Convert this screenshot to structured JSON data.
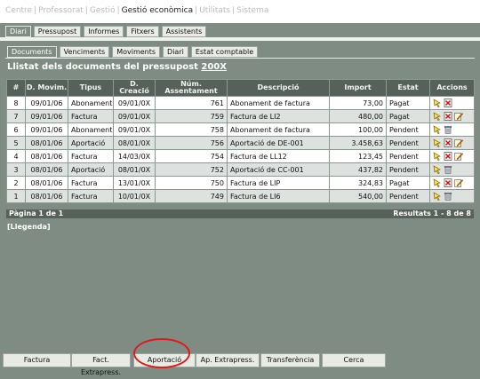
{
  "top_nav": [
    "Centre",
    "Professorat",
    "Gestió",
    "Gestió econòmica",
    "Utilitats",
    "Sistema"
  ],
  "top_nav_active": 3,
  "top_nav_separator": "|",
  "tabs_primary": [
    "Diari",
    "Pressupost",
    "Informes",
    "Fitxers",
    "Assistents"
  ],
  "tabs_secondary": [
    "Documents",
    "Venciments",
    "Moviments",
    "Diari",
    "Estat comptable"
  ],
  "page_title_prefix": "Llistat dels documents del pressupost",
  "page_title_year": "200X",
  "table": {
    "headers": [
      "#",
      "D. Movim.",
      "Tipus",
      "D. Creació",
      "Núm. Assentament",
      "Descripció",
      "Import",
      "Estat",
      "Accions"
    ],
    "rows": [
      {
        "n": "8",
        "date": "09/01/06",
        "type": "Abonament",
        "created": "09/01/0X",
        "entry": "761",
        "desc": "Abonament de factura",
        "amount": "73,00",
        "state": "Pagat",
        "actions": [
          "select-icon",
          "delete-icon"
        ]
      },
      {
        "n": "7",
        "date": "09/01/06",
        "type": "Factura",
        "created": "09/01/0X",
        "entry": "759",
        "desc": "Factura de LI2",
        "amount": "480,00",
        "state": "Pagat",
        "actions": [
          "select-icon",
          "delete-icon",
          "edit-icon"
        ]
      },
      {
        "n": "6",
        "date": "09/01/06",
        "type": "Abonament",
        "created": "09/01/0X",
        "entry": "758",
        "desc": "Abonament de factura",
        "amount": "100,00",
        "state": "Pendent",
        "actions": [
          "select-icon",
          "trash-icon"
        ]
      },
      {
        "n": "5",
        "date": "08/01/06",
        "type": "Aportació",
        "created": "08/01/0X",
        "entry": "756",
        "desc": "Aportació de DE-001",
        "amount": "3.458,63",
        "state": "Pendent",
        "actions": [
          "select-icon",
          "delete-icon",
          "edit-icon"
        ]
      },
      {
        "n": "4",
        "date": "08/01/06",
        "type": "Factura",
        "created": "14/03/0X",
        "entry": "754",
        "desc": "Factura de LL12",
        "amount": "123,45",
        "state": "Pendent",
        "actions": [
          "select-icon",
          "delete-icon",
          "edit-icon"
        ]
      },
      {
        "n": "3",
        "date": "08/01/06",
        "type": "Aportació",
        "created": "08/01/0X",
        "entry": "752",
        "desc": "Aportació de CC-001",
        "amount": "437,82",
        "state": "Pendent",
        "actions": [
          "select-icon",
          "trash-icon"
        ]
      },
      {
        "n": "2",
        "date": "08/01/06",
        "type": "Factura",
        "created": "13/01/0X",
        "entry": "750",
        "desc": "Factura de LIP",
        "amount": "324,83",
        "state": "Pagat",
        "actions": [
          "select-icon",
          "delete-icon",
          "edit-icon"
        ]
      },
      {
        "n": "1",
        "date": "08/01/06",
        "type": "Factura",
        "created": "10/01/0X",
        "entry": "749",
        "desc": "Factura de LI6",
        "amount": "540,00",
        "state": "Pendent",
        "actions": [
          "select-icon",
          "trash-icon"
        ]
      }
    ]
  },
  "footer": {
    "page": "Pàgina 1 de 1",
    "results": "Resultats 1 - 8 de 8"
  },
  "legend": "[Llegenda]",
  "bottom_buttons": [
    "Factura",
    "Fact. Extrapress.",
    "Aportació",
    "Ap. Extrapress.",
    "Transferència",
    "Cerca"
  ],
  "colors": {
    "background": "#7e8c84",
    "header": "#566159",
    "row_alt": "#dde2de",
    "highlight_circle": "#e21818"
  }
}
